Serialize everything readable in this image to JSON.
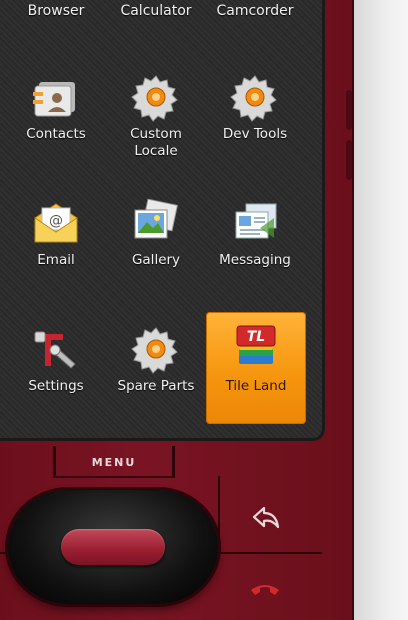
{
  "top_row": [
    "Browser",
    "Calculator",
    "Camcorder"
  ],
  "apps": [
    {
      "label": "Contacts",
      "icon": "contacts-icon"
    },
    {
      "label": "Custom\nLocale",
      "icon": "custom-locale-gear-icon"
    },
    {
      "label": "Dev Tools",
      "icon": "dev-tools-gear-icon"
    },
    {
      "label": "Email",
      "icon": "email-icon"
    },
    {
      "label": "Gallery",
      "icon": "gallery-icon"
    },
    {
      "label": "Messaging",
      "icon": "messaging-icon"
    },
    {
      "label": "Settings",
      "icon": "settings-icon"
    },
    {
      "label": "Spare Parts",
      "icon": "spare-parts-gear-icon"
    },
    {
      "label": "Tile Land",
      "icon": "tile-land-icon",
      "logo_text": "TL",
      "highlighted": true
    }
  ],
  "hardware": {
    "menu_label": "MENU"
  },
  "colors": {
    "phone_body": "#7a1424",
    "screen_bg": "#2a2a2a",
    "highlight": "#f6960e",
    "dpad_center": "#9c2033"
  }
}
